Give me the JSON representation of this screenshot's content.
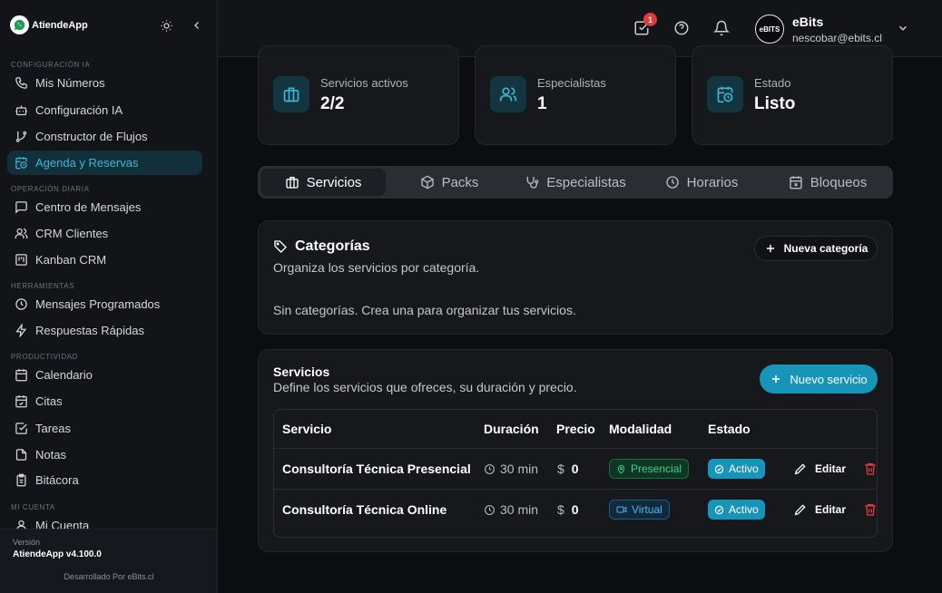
{
  "app": {
    "logo_text": "AtiendeApp"
  },
  "sidebar": {
    "sections": [
      {
        "label": "CONFIGURACIÓN IA"
      },
      {
        "label": "OPERACIÓN DIARIA"
      },
      {
        "label": "HERRAMIENTAS"
      },
      {
        "label": "PRODUCTIVIDAD"
      },
      {
        "label": "MI CUENTA"
      }
    ],
    "items": [
      {
        "label": "Mis Números",
        "icon": "phone-icon"
      },
      {
        "label": "Configuración IA",
        "icon": "bot-icon"
      },
      {
        "label": "Constructor de Flujos",
        "icon": "git-branch-icon"
      },
      {
        "label": "Agenda y Reservas",
        "icon": "calendar-clock-icon",
        "active": true
      },
      {
        "label": "Centro de Mensajes",
        "icon": "message-icon"
      },
      {
        "label": "CRM Clientes",
        "icon": "users-icon"
      },
      {
        "label": "Kanban CRM",
        "icon": "kanban-icon"
      },
      {
        "label": "Mensajes Programados",
        "icon": "clock-icon"
      },
      {
        "label": "Respuestas Rápidas",
        "icon": "zap-icon"
      },
      {
        "label": "Calendario",
        "icon": "calendar-icon"
      },
      {
        "label": "Citas",
        "icon": "calendar-check-icon"
      },
      {
        "label": "Tareas",
        "icon": "check-square-icon"
      },
      {
        "label": "Notas",
        "icon": "file-icon"
      },
      {
        "label": "Bitácora",
        "icon": "clipboard-icon"
      },
      {
        "label": "Mi Cuenta",
        "icon": "user-icon"
      }
    ],
    "footer": {
      "version_label": "Versión",
      "version_value": "AtiendeApp v4.100.0",
      "developer": "Desarrollado Por eBits.cl"
    }
  },
  "header": {
    "tasks_badge": "1",
    "user": {
      "name": "eBits",
      "email": "nescobar@ebits.cl",
      "avatar_text": "eBITS"
    }
  },
  "stats": [
    {
      "label": "Servicios activos",
      "value": "2/2",
      "icon": "briefcase-icon"
    },
    {
      "label": "Especialistas",
      "value": "1",
      "icon": "users-icon"
    },
    {
      "label": "Estado",
      "value": "Listo",
      "icon": "calendar-clock-icon"
    }
  ],
  "tabs": [
    {
      "label": "Servicios",
      "icon": "briefcase-icon",
      "active": true
    },
    {
      "label": "Packs",
      "icon": "package-icon"
    },
    {
      "label": "Especialistas",
      "icon": "stethoscope-icon"
    },
    {
      "label": "Horarios",
      "icon": "clock-icon"
    },
    {
      "label": "Bloqueos",
      "icon": "calendar-x-icon"
    }
  ],
  "categories": {
    "title": "Categorías",
    "subtitle": "Organiza los servicios por categoría.",
    "new_button": "Nueva categoría",
    "empty_text": "Sin categorías. Crea una para organizar tus servicios."
  },
  "services": {
    "title": "Servicios",
    "subtitle": "Define los servicios que ofreces, su duración y precio.",
    "new_button": "Nuevo servicio",
    "columns": [
      "Servicio",
      "Duración",
      "Precio",
      "Modalidad",
      "Estado"
    ],
    "rows": [
      {
        "name": "Consultoría Técnica Presencial",
        "duration": "30 min",
        "currency": "$",
        "price": "0",
        "modality": "Presencial",
        "status": "Activo",
        "edit": "Editar"
      },
      {
        "name": "Consultoría Técnica Online",
        "duration": "30 min",
        "currency": "$",
        "price": "0",
        "modality": "Virtual",
        "status": "Activo",
        "edit": "Editar"
      }
    ]
  },
  "colors": {
    "accent": "#1695b8",
    "accent_text": "#3fb6d6",
    "success": "#34d58a",
    "danger": "#e23a3a",
    "background": "#0b0d10"
  }
}
